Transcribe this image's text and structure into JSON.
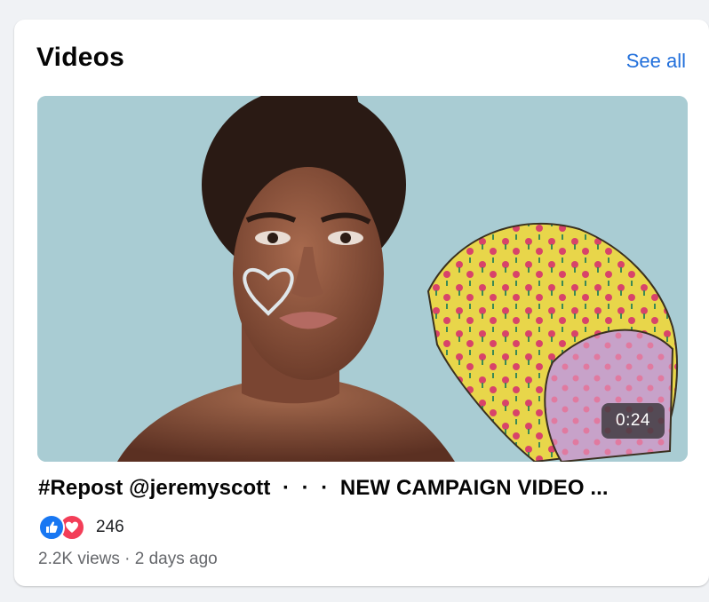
{
  "section": {
    "title": "Videos",
    "see_all_label": "See all"
  },
  "video": {
    "duration": "0:24",
    "title": "#Repost @jeremyscott  ·  ·  ·  NEW CAMPAIGN VIDEO ...",
    "reaction_count": "246",
    "views": "2.2K views",
    "separator": "·",
    "posted": "2 days ago",
    "reactions": [
      "like-icon",
      "love-icon"
    ]
  },
  "colors": {
    "link": "#216fdb",
    "like": "#1877f2",
    "love": "#f33e58",
    "thumbnail_background": "#a9ccd3"
  }
}
